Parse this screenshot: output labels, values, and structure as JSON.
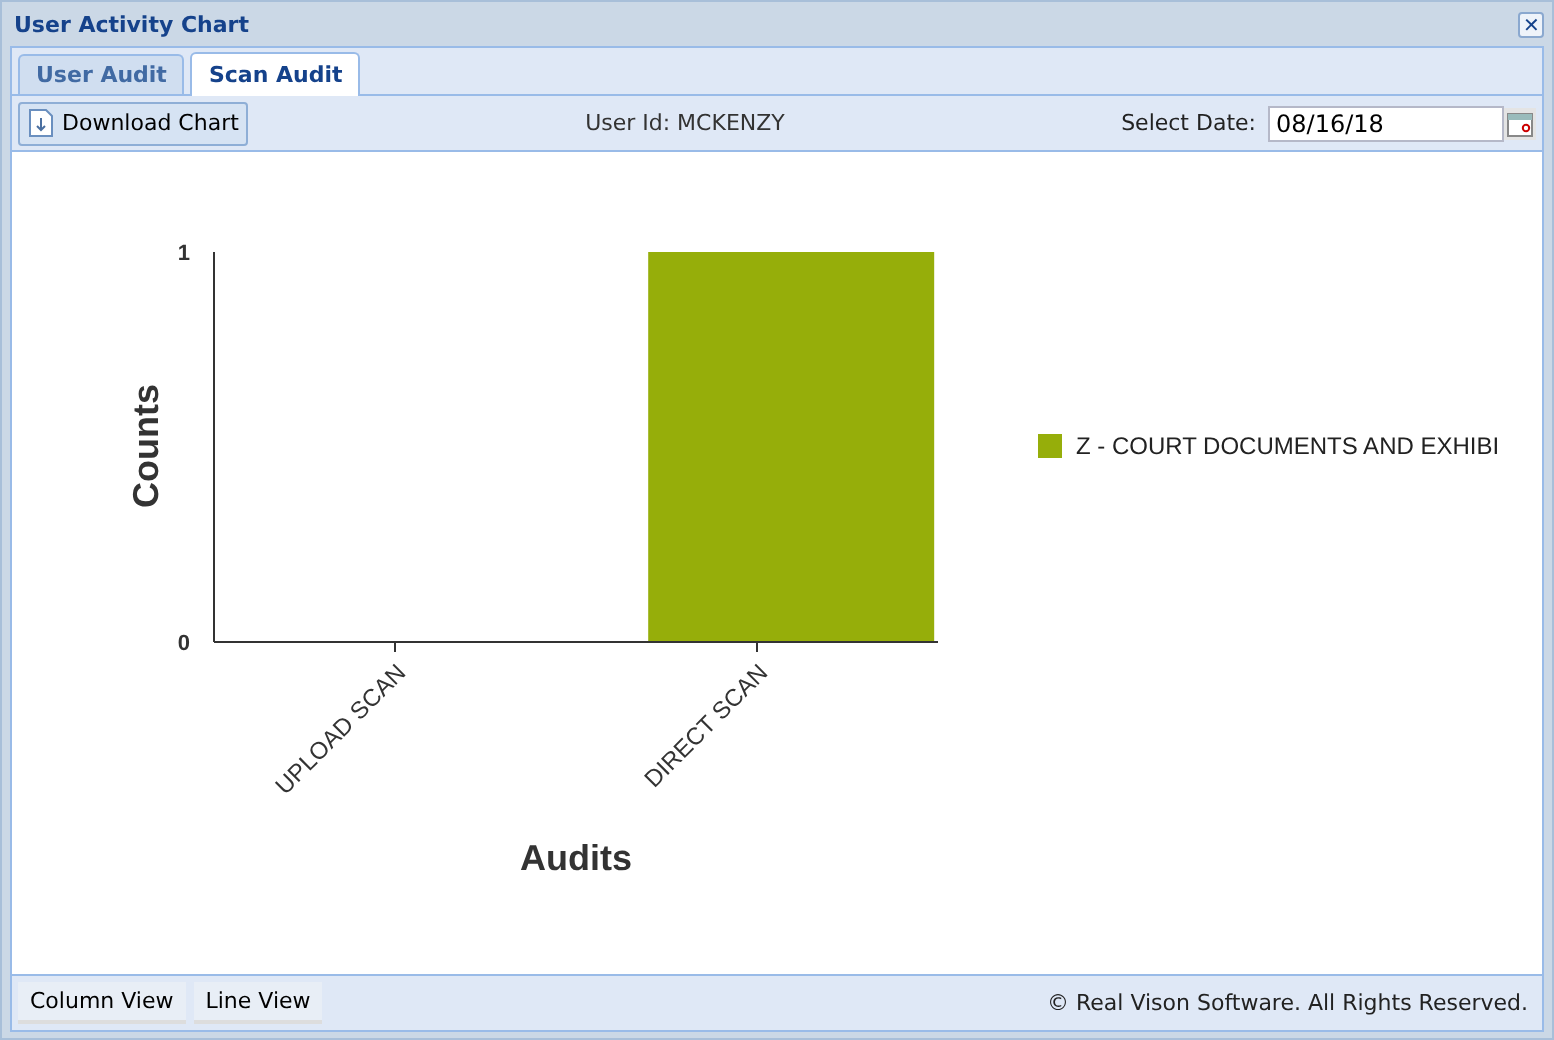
{
  "window": {
    "title": "User Activity Chart",
    "close": "✕"
  },
  "tabs": [
    {
      "label": "User Audit",
      "selected": false
    },
    {
      "label": "Scan Audit",
      "selected": true
    }
  ],
  "toolbar": {
    "download_button": "Download Chart",
    "user_id": "User Id: MCKENZY",
    "date_label": "Select Date:",
    "date_value": "08/16/18"
  },
  "chart": {
    "chart_data": {
      "type": "bar",
      "xlabel": "Audits",
      "ylabel": "Counts",
      "categories": [
        "UPLOAD SCAN",
        "DIRECT SCAN"
      ],
      "series": [
        {
          "name": "Z - COURT DOCUMENTS AND EXHIBI",
          "color": "#96ae0a",
          "values": [
            0,
            1
          ]
        }
      ],
      "ylim": [
        0,
        1
      ],
      "yticks": [
        0,
        1
      ]
    }
  },
  "footer": {
    "buttons": [
      "Column View",
      "Line View"
    ],
    "copyright": "© Real Vison Software. All Rights Reserved."
  }
}
